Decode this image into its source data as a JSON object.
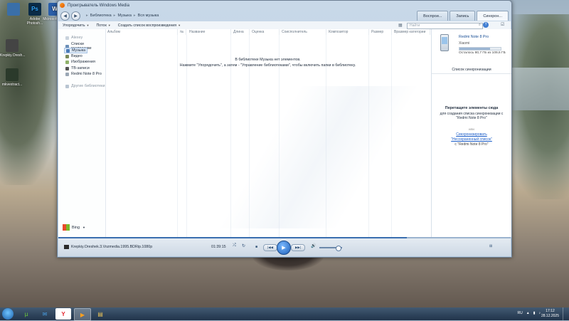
{
  "desktop": {
    "icons": [
      {
        "label": "",
        "color": "#3a6fa8"
      },
      {
        "label": "Adobe Photosh...",
        "color": "#0a2b47",
        "glyph": "Ps"
      },
      {
        "label": "Microsoft Word",
        "color": "#2a5ea8",
        "glyph": "W"
      },
      {
        "label": "Krepkiy.Oresh...",
        "color": "#444444"
      },
      {
        "label": "mkvextract...",
        "color": "#2b3a2b"
      }
    ]
  },
  "window": {
    "title": "Проигрыватель Windows Media",
    "breadcrumbs": [
      "Библиотека",
      "Музыка",
      "Вся музыка"
    ],
    "tabs": [
      "Воспрои...",
      "Запись",
      "Синхрон..."
    ],
    "active_tab_index": 2,
    "toolbar": {
      "organize": "Упорядочить",
      "stream": "Поток",
      "create_playlist": "Создать список воспроизведения",
      "search_placeholder": "Найти"
    }
  },
  "nav": {
    "user": "Alexey",
    "playlists": "Списки воспроизве",
    "music": "Музыка",
    "video": "Видео",
    "pictures": "Изображения",
    "tv": "ТВ-записи",
    "device": "Redmi Note 8 Pro",
    "other_libraries": "Другие библиотеки",
    "bing": "Bing"
  },
  "columns": [
    "Альбом",
    "№",
    "Название",
    "Длина",
    "Оценка",
    "Соисполнитель",
    "Композитор",
    "Размер",
    "Вразмер категории"
  ],
  "empty_message": {
    "line1": "В библиотеке Музыка нет элементов.",
    "line2": "Нажмите \"Упорядочить\", а затем - \"Управление библиотеками\", чтобы включить папки в библиотеку."
  },
  "sync": {
    "device_name": "Redmi Note 8 Pro",
    "maker": "Xiaomi",
    "capacity_fraction": 0.74,
    "capacity_text": "Осталось 80,7 ГБ из 109,6 ГБ",
    "list_title": "Список синхронизации",
    "drag_title": "Перетащите элементы сюда",
    "drag_text": "для создания списка синхронизации с \"Redmi Note 8 Pro\"",
    "or": "или",
    "link1": "Синхронизировать",
    "link2": "\"Несохраненный список\"",
    "note": "с \"Redmi Note 8 Pro\""
  },
  "player": {
    "now_playing": "Krepkiy.Oreshek.3.Vozmedia.1995.BDRip.1080p",
    "time": "01:39:15",
    "progress_fraction": 0.77,
    "volume_fraction": 0.8
  },
  "taskbar": {
    "apps": [
      "utorrent",
      "mail",
      "yandex",
      "wmp",
      "explorer"
    ],
    "active_app": "wmp",
    "tray": [
      "RU"
    ],
    "time": "17:12",
    "date": "28.12.2025"
  }
}
